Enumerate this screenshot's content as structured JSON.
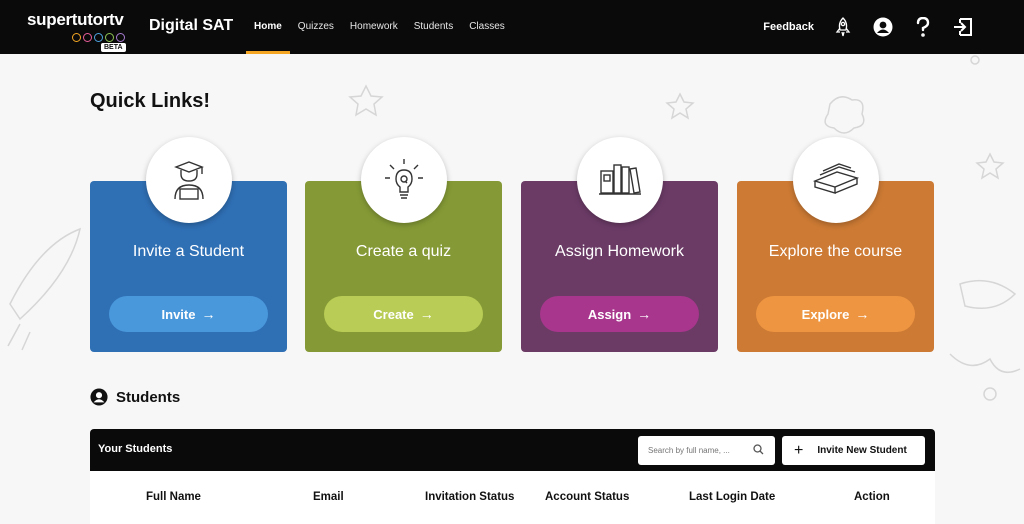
{
  "header": {
    "brand": "supertutortv",
    "beta": "BETA",
    "app_title": "Digital SAT",
    "nav": [
      {
        "label": "Home",
        "active": true
      },
      {
        "label": "Quizzes",
        "active": false
      },
      {
        "label": "Homework",
        "active": false
      },
      {
        "label": "Students",
        "active": false
      },
      {
        "label": "Classes",
        "active": false
      }
    ],
    "feedback": "Feedback",
    "icons": [
      "rocket-icon",
      "user-circle-icon",
      "help-icon",
      "logout-icon"
    ],
    "dot_colors": [
      "#f5a623",
      "#e85d9a",
      "#4da3e0",
      "#8cc152",
      "#a77bd0"
    ]
  },
  "quick_links": {
    "title": "Quick Links!",
    "cards": [
      {
        "title": "Invite a Student",
        "button": "Invite",
        "icon": "graduate-icon",
        "bg": "#2f6fb4",
        "btn": "#4a98dc"
      },
      {
        "title": "Create a quiz",
        "button": "Create",
        "icon": "lightbulb-icon",
        "bg": "#859a36",
        "btn": "#b9cc55"
      },
      {
        "title": "Assign Homework",
        "button": "Assign",
        "icon": "books-icon",
        "bg": "#6b3b66",
        "btn": "#a8368d"
      },
      {
        "title": "Explore the course",
        "button": "Explore",
        "icon": "book-stack-icon",
        "bg": "#cc7a34",
        "btn": "#ee9541"
      }
    ]
  },
  "students": {
    "title": "Students",
    "panel_title": "Your Students",
    "search_placeholder": "Search by full name, ...",
    "invite_button": "Invite New Student",
    "columns": [
      "Full Name",
      "Email",
      "Invitation Status",
      "Account Status",
      "Last Login Date",
      "Action"
    ]
  }
}
